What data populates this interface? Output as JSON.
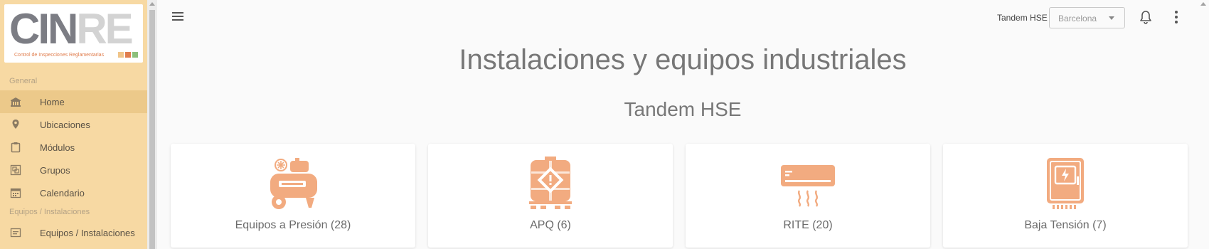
{
  "logo": {
    "part1": "CIN",
    "part2": "RE",
    "subtitle": "Control de Inspecciones Reglamentarias",
    "square_colors": [
      "#f0c58a",
      "#e07d4d",
      "#8cc07b"
    ]
  },
  "sidebar": {
    "sections": [
      {
        "title": "General",
        "items": [
          {
            "label": "Home",
            "icon": "home-icon",
            "active": true
          },
          {
            "label": "Ubicaciones",
            "icon": "location-pin-icon"
          },
          {
            "label": "Módulos",
            "icon": "clipboard-icon"
          },
          {
            "label": "Grupos",
            "icon": "group-icon"
          },
          {
            "label": "Calendario",
            "icon": "calendar-icon"
          }
        ]
      },
      {
        "title": "Equipos / Instalaciones",
        "items": [
          {
            "label": "Equipos / Instalaciones",
            "icon": "list-card-icon"
          }
        ]
      }
    ]
  },
  "header": {
    "company": "Tandem HSE",
    "location_select": {
      "value": "Barcelona"
    }
  },
  "main": {
    "title": "Instalaciones y equipos industriales",
    "company_title": "Tandem HSE",
    "cards": [
      {
        "label": "Equipos a Presión (28)",
        "icon": "compressor-icon"
      },
      {
        "label": "APQ (6)",
        "icon": "chemical-tank-icon"
      },
      {
        "label": "RITE (20)",
        "icon": "air-conditioner-icon"
      },
      {
        "label": "Baja Tensión (7)",
        "icon": "electrical-panel-icon"
      }
    ]
  },
  "colors": {
    "sidebar_bg": "#f7d9a3",
    "sidebar_active": "#ecc98a",
    "icon_accent": "#f2ab80",
    "page_bg": "#fafafa"
  }
}
